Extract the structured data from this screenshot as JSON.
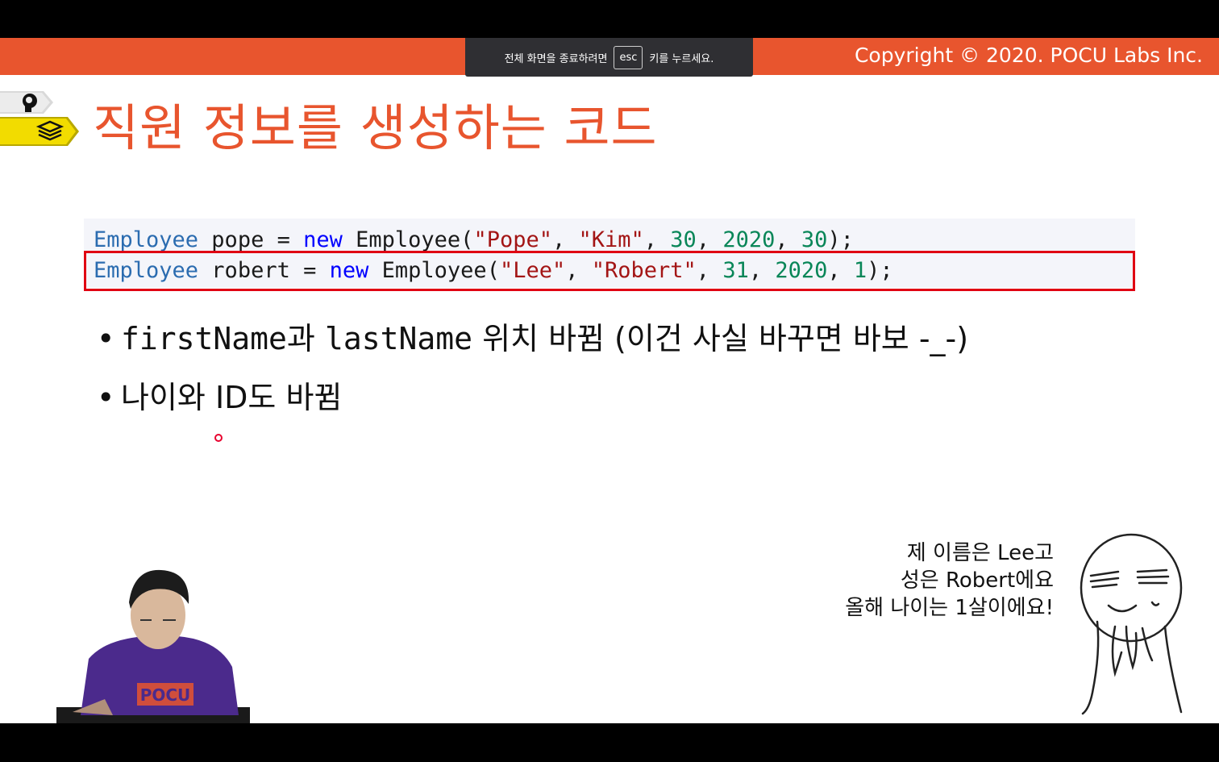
{
  "header": {
    "copyright": "Copyright © 2020. POCU Labs Inc.",
    "brand_color": "#e8552e"
  },
  "fullscreen_toast": {
    "before": "전체 화면을 종료하려면",
    "key": "esc",
    "after": "키를 누르세요."
  },
  "slide": {
    "title": "직원 정보를 생성하는 코드",
    "nav_icons": [
      "brain-head-icon",
      "book-stack-icon"
    ],
    "code": {
      "line1": {
        "type": "Employee",
        "name": " pope = ",
        "kw": "new",
        "ctor": " Employee(",
        "s1": "\"Pope\"",
        "c1": ", ",
        "s2": "\"Kim\"",
        "c2": ", ",
        "n1": "30",
        "c3": ", ",
        "n2": "2020",
        "c4": ", ",
        "n3": "30",
        "end": ");"
      },
      "line2": {
        "type": "Employee",
        "name": " robert = ",
        "kw": "new",
        "ctor": " Employee(",
        "s1": "\"Lee\"",
        "c1": ", ",
        "s2": "\"Robert\"",
        "c2": ", ",
        "n1": "31",
        "c3": ", ",
        "n2": "2020",
        "c4": ", ",
        "n3": "1",
        "end": ");"
      },
      "highlight_color": "#e00012"
    },
    "bullets": [
      {
        "dot": "•",
        "code1": "firstName",
        "t1": "과 ",
        "code2": "lastName",
        "t2": " 위치 바뀜 (이건 사실 바꾸면 바보 -_-)"
      },
      {
        "dot": "•",
        "text": "나이와 ID도 바뀜"
      }
    ],
    "speech": [
      "제 이름은 Lee고",
      "성은 Robert에요",
      "올해 나이는 1살이에요!"
    ],
    "presenter_shirt": "POCU"
  }
}
